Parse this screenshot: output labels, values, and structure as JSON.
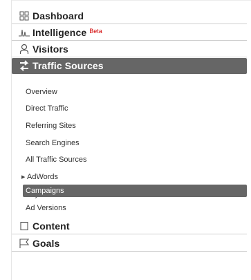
{
  "nav": {
    "dashboard": {
      "label": "Dashboard",
      "icon": "grid-icon"
    },
    "intelligence": {
      "label": "Intelligence",
      "badge": "Beta",
      "icon": "pulse-icon"
    },
    "visitors": {
      "label": "Visitors",
      "icon": "person-icon"
    },
    "traffic_sources": {
      "label": "Traffic Sources",
      "icon": "traffic-arrows-icon"
    },
    "sub_items": [
      {
        "label": "Overview"
      },
      {
        "label": "Direct Traffic"
      },
      {
        "label": "Referring Sites"
      },
      {
        "label": "Search Engines"
      },
      {
        "label": "All Traffic Sources"
      },
      {
        "label": "AdWords",
        "expandable": true
      },
      {
        "label": "Keywords"
      },
      {
        "label": "Campaigns",
        "selected": true
      },
      {
        "label": "Ad Versions"
      }
    ],
    "content": {
      "label": "Content",
      "icon": "document-icon"
    },
    "goals": {
      "label": "Goals",
      "icon": "flag-icon"
    }
  },
  "colors": {
    "active_bg": "#666666",
    "beta": "#d20000"
  }
}
